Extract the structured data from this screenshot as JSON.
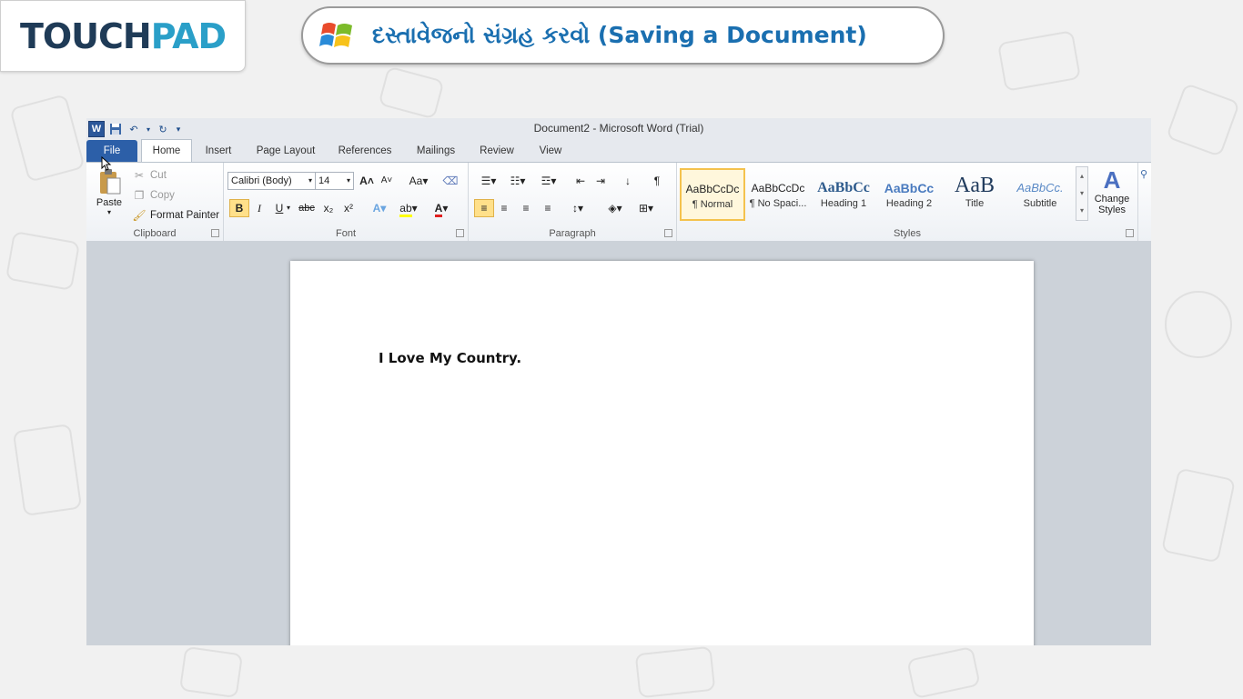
{
  "logo": {
    "part1": "TOUCH",
    "part2": "PAD"
  },
  "banner": {
    "title": "દસ્તાવેજનો સંગ્રહ કરવો (Saving a Document)"
  },
  "window": {
    "title": "Document2 - Microsoft Word (Trial)"
  },
  "tabs": [
    "File",
    "Home",
    "Insert",
    "Page Layout",
    "References",
    "Mailings",
    "Review",
    "View"
  ],
  "clipboard": {
    "paste": "Paste",
    "cut": "Cut",
    "copy": "Copy",
    "format_painter": "Format Painter",
    "label": "Clipboard"
  },
  "font": {
    "family": "Calibri (Body)",
    "size": "14",
    "label": "Font",
    "bold": "B",
    "italic": "I",
    "underline": "U",
    "strike": "abc",
    "subscript": "x₂",
    "superscript": "x²",
    "change_case": "Aa"
  },
  "paragraph": {
    "label": "Paragraph",
    "pilcrow": "¶"
  },
  "styles": {
    "label": "Styles",
    "items": [
      {
        "preview": "AaBbCcDc",
        "name": "¶ Normal"
      },
      {
        "preview": "AaBbCcDc",
        "name": "¶ No Spaci..."
      },
      {
        "preview": "AaBbCc",
        "name": "Heading 1"
      },
      {
        "preview": "AaBbCc",
        "name": "Heading 2"
      },
      {
        "preview": "AaB",
        "name": "Title"
      },
      {
        "preview": "AaBbCc.",
        "name": "Subtitle"
      }
    ],
    "change_styles_line1": "Change",
    "change_styles_line2": "Styles"
  },
  "document": {
    "text": "I Love My Country."
  }
}
